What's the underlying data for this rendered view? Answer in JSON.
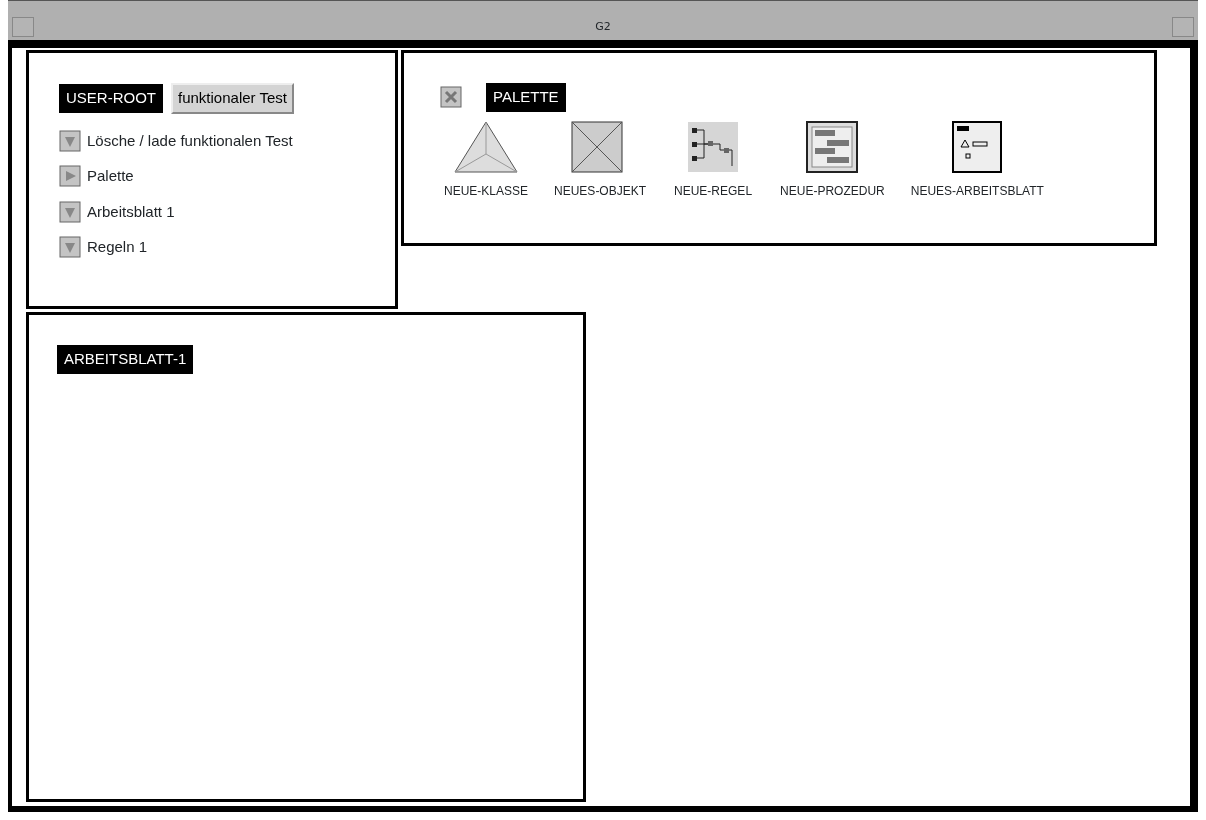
{
  "window": {
    "title": "G2"
  },
  "user_root": {
    "title": "USER-ROOT",
    "button": "funktionaler Test",
    "items": [
      {
        "kind": "down",
        "label": "Lösche / lade funktionalen Test"
      },
      {
        "kind": "right",
        "label": "Palette"
      },
      {
        "kind": "down",
        "label": "Arbeitsblatt 1"
      },
      {
        "kind": "down",
        "label": "Regeln 1"
      }
    ]
  },
  "palette": {
    "title": "PALETTE",
    "items": [
      {
        "kind": "class",
        "label": "NEUE-KLASSE"
      },
      {
        "kind": "object",
        "label": "NEUES-OBJEKT"
      },
      {
        "kind": "rule",
        "label": "NEUE-REGEL"
      },
      {
        "kind": "procedure",
        "label": "NEUE-PROZEDUR"
      },
      {
        "kind": "workspace",
        "label": "NEUES-ARBEITSBLATT"
      }
    ]
  },
  "worksheet": {
    "title": "ARBEITSBLATT-1"
  }
}
